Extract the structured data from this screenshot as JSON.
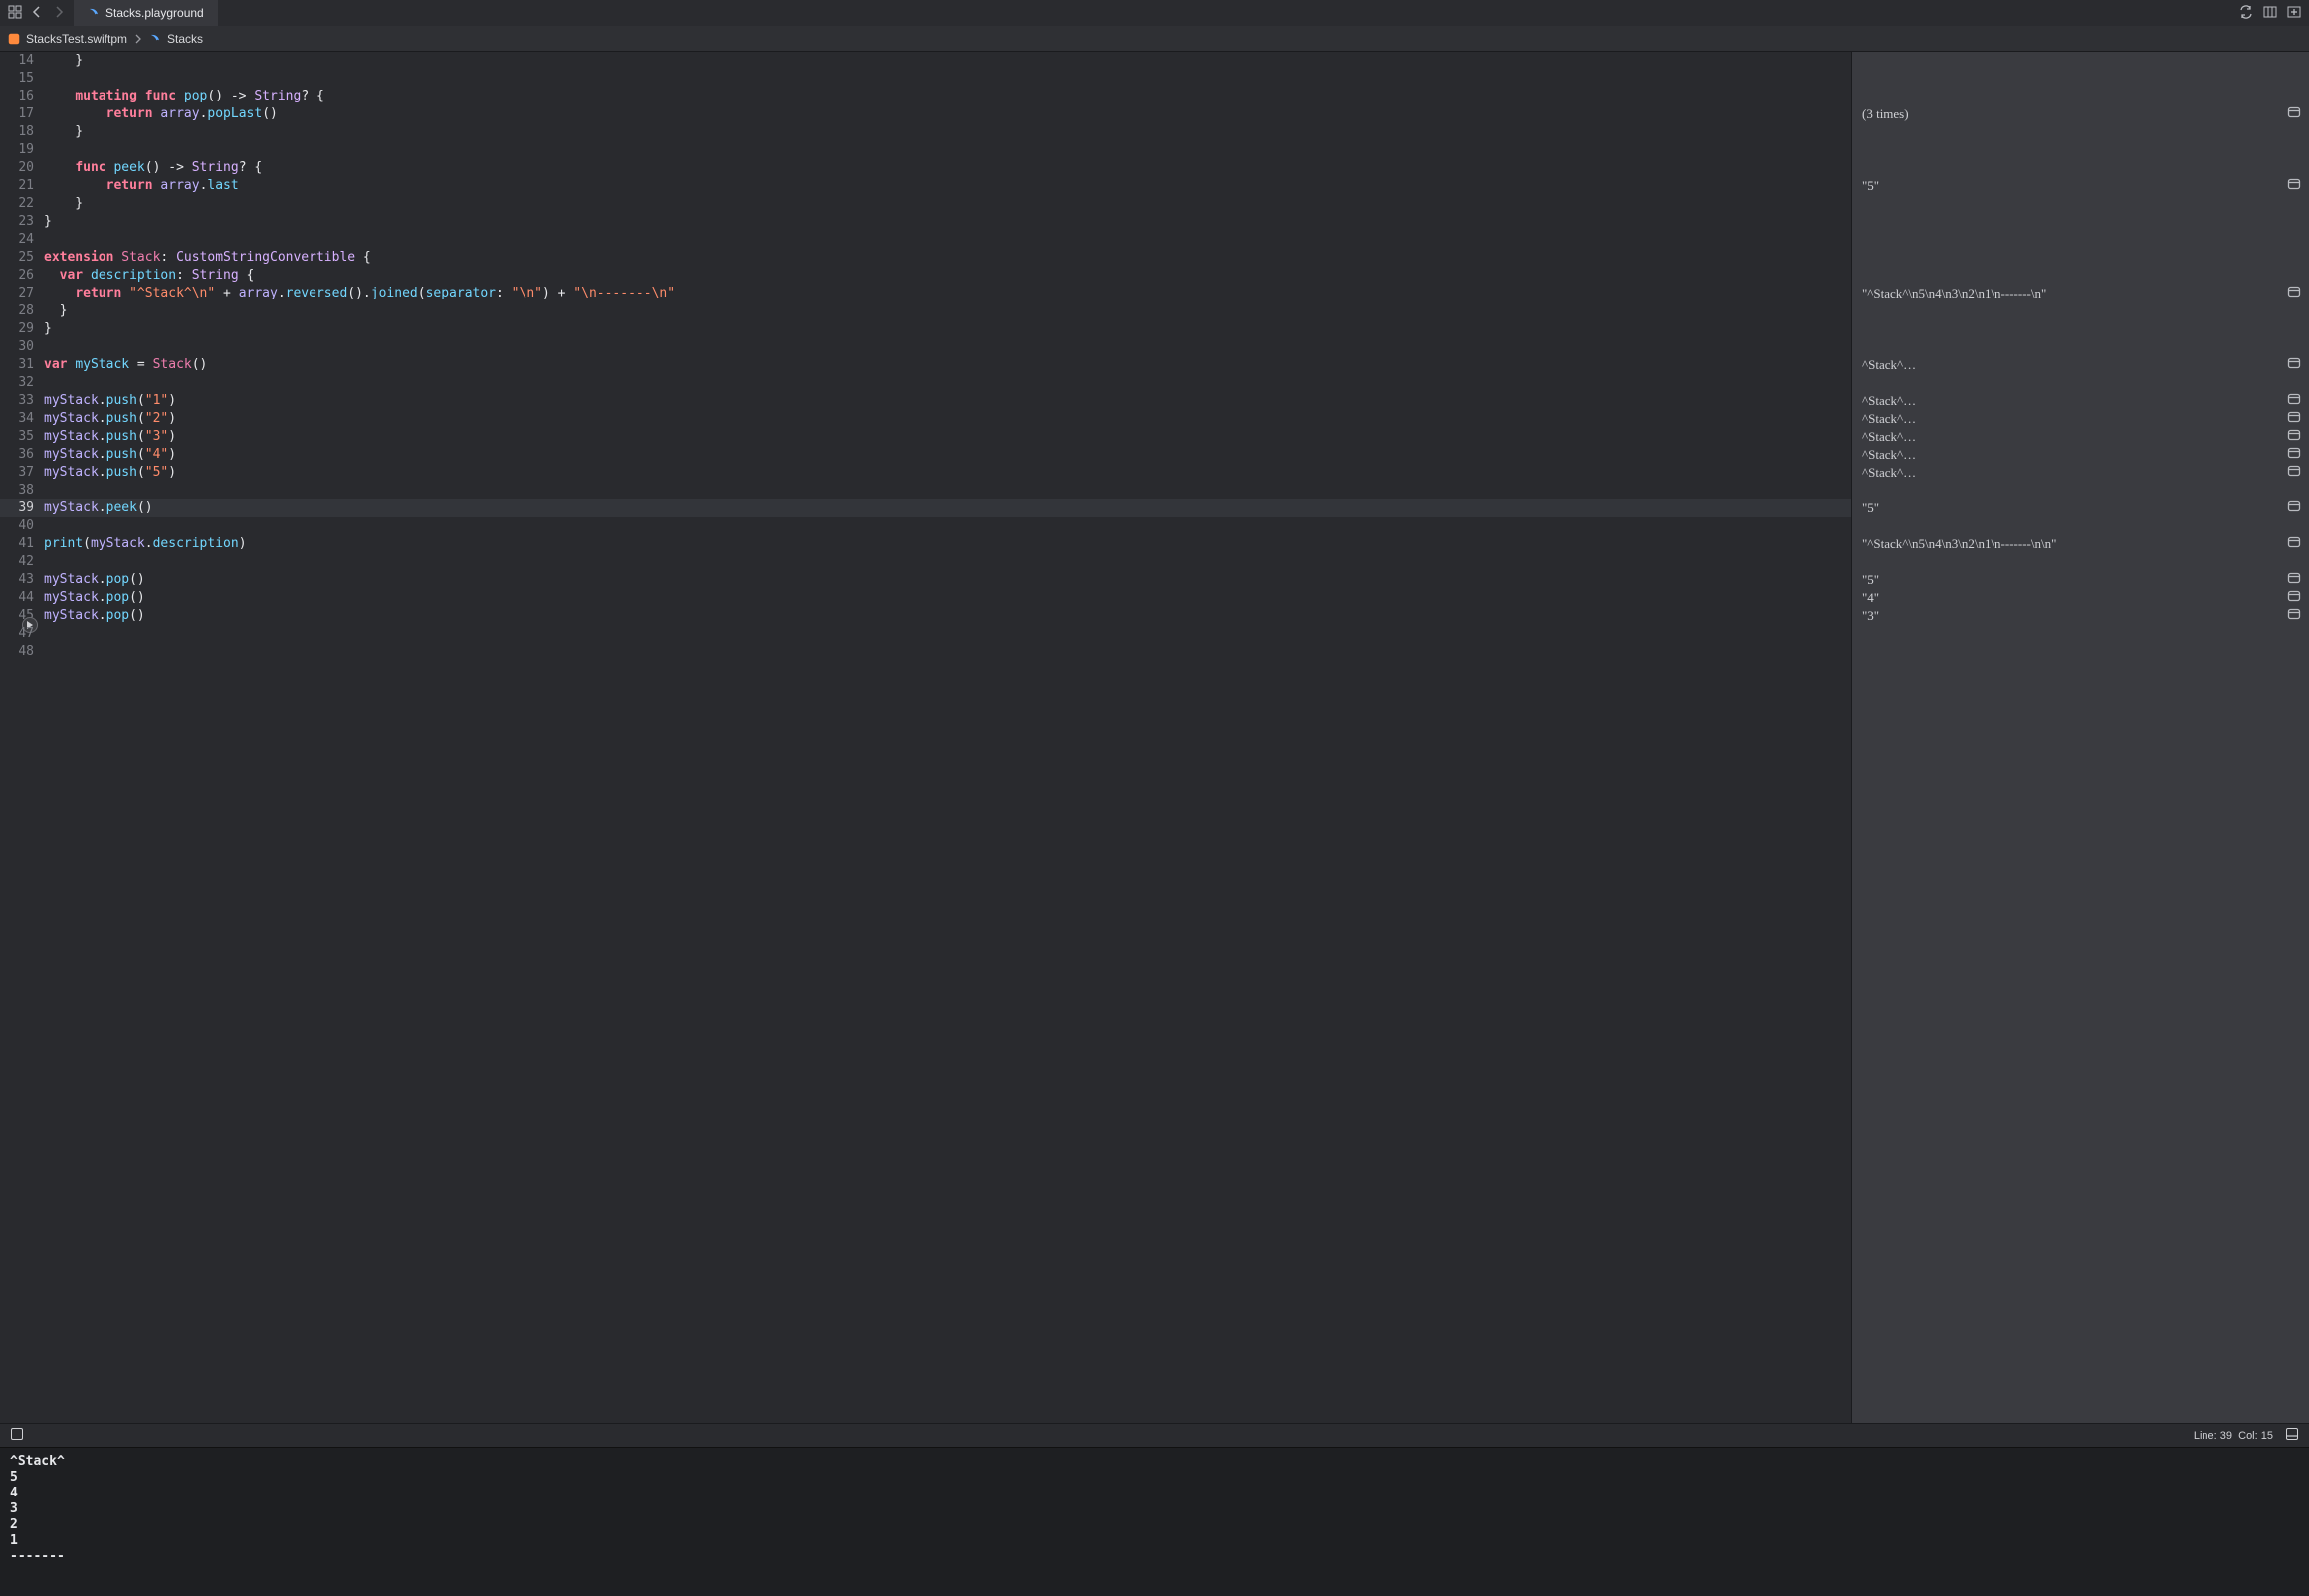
{
  "toolbar": {
    "tab_label": "Stacks.playground"
  },
  "breadcrumb": {
    "project": "StacksTest.swiftpm",
    "file": "Stacks"
  },
  "editor": {
    "first_line_number": 14,
    "current_line_number": 39,
    "play_line_number": 46,
    "lines": [
      {
        "n": 14,
        "tokens": [
          {
            "t": "    }",
            "c": "tok-plain"
          }
        ]
      },
      {
        "n": 15,
        "tokens": []
      },
      {
        "n": 16,
        "tokens": [
          {
            "t": "    ",
            "c": ""
          },
          {
            "t": "mutating func ",
            "c": "tok-kw"
          },
          {
            "t": "pop",
            "c": "tok-fn"
          },
          {
            "t": "() -> ",
            "c": "tok-plain"
          },
          {
            "t": "String",
            "c": "tok-type"
          },
          {
            "t": "? {",
            "c": "tok-plain"
          }
        ]
      },
      {
        "n": 17,
        "tokens": [
          {
            "t": "        ",
            "c": ""
          },
          {
            "t": "return ",
            "c": "tok-kw"
          },
          {
            "t": "array",
            "c": "tok-id"
          },
          {
            "t": ".",
            "c": "tok-plain"
          },
          {
            "t": "popLast",
            "c": "tok-name"
          },
          {
            "t": "()",
            "c": "tok-plain"
          }
        ]
      },
      {
        "n": 18,
        "tokens": [
          {
            "t": "    }",
            "c": "tok-plain"
          }
        ]
      },
      {
        "n": 19,
        "tokens": []
      },
      {
        "n": 20,
        "tokens": [
          {
            "t": "    ",
            "c": ""
          },
          {
            "t": "func ",
            "c": "tok-kw"
          },
          {
            "t": "peek",
            "c": "tok-fn"
          },
          {
            "t": "() -> ",
            "c": "tok-plain"
          },
          {
            "t": "String",
            "c": "tok-type"
          },
          {
            "t": "? {",
            "c": "tok-plain"
          }
        ]
      },
      {
        "n": 21,
        "tokens": [
          {
            "t": "        ",
            "c": ""
          },
          {
            "t": "return ",
            "c": "tok-kw"
          },
          {
            "t": "array",
            "c": "tok-id"
          },
          {
            "t": ".",
            "c": "tok-plain"
          },
          {
            "t": "last",
            "c": "tok-name"
          }
        ]
      },
      {
        "n": 22,
        "tokens": [
          {
            "t": "    }",
            "c": "tok-plain"
          }
        ]
      },
      {
        "n": 23,
        "tokens": [
          {
            "t": "}",
            "c": "tok-plain"
          }
        ]
      },
      {
        "n": 24,
        "tokens": []
      },
      {
        "n": 25,
        "tokens": [
          {
            "t": "extension ",
            "c": "tok-kw"
          },
          {
            "t": "Stack",
            "c": "tok-pink"
          },
          {
            "t": ": ",
            "c": "tok-plain"
          },
          {
            "t": "CustomStringConvertible",
            "c": "tok-type"
          },
          {
            "t": " {",
            "c": "tok-plain"
          }
        ]
      },
      {
        "n": 26,
        "tokens": [
          {
            "t": "  ",
            "c": ""
          },
          {
            "t": "var ",
            "c": "tok-kw"
          },
          {
            "t": "description",
            "c": "tok-fn"
          },
          {
            "t": ": ",
            "c": "tok-plain"
          },
          {
            "t": "String",
            "c": "tok-type"
          },
          {
            "t": " {",
            "c": "tok-plain"
          }
        ]
      },
      {
        "n": 27,
        "tokens": [
          {
            "t": "    ",
            "c": ""
          },
          {
            "t": "return ",
            "c": "tok-kw"
          },
          {
            "t": "\"^Stack^\\n\"",
            "c": "tok-str"
          },
          {
            "t": " + ",
            "c": "tok-plain"
          },
          {
            "t": "array",
            "c": "tok-id"
          },
          {
            "t": ".",
            "c": "tok-plain"
          },
          {
            "t": "reversed",
            "c": "tok-name"
          },
          {
            "t": "().",
            "c": "tok-plain"
          },
          {
            "t": "joined",
            "c": "tok-name"
          },
          {
            "t": "(",
            "c": "tok-plain"
          },
          {
            "t": "separator",
            "c": "tok-name"
          },
          {
            "t": ": ",
            "c": "tok-plain"
          },
          {
            "t": "\"\\n\"",
            "c": "tok-str"
          },
          {
            "t": ") + ",
            "c": "tok-plain"
          },
          {
            "t": "\"\\n-------\\n\"",
            "c": "tok-str"
          }
        ]
      },
      {
        "n": 28,
        "tokens": [
          {
            "t": "  }",
            "c": "tok-plain"
          }
        ]
      },
      {
        "n": 29,
        "tokens": [
          {
            "t": "}",
            "c": "tok-plain"
          }
        ]
      },
      {
        "n": 30,
        "tokens": []
      },
      {
        "n": 31,
        "tokens": [
          {
            "t": "var ",
            "c": "tok-kw"
          },
          {
            "t": "myStack",
            "c": "tok-fn"
          },
          {
            "t": " = ",
            "c": "tok-plain"
          },
          {
            "t": "Stack",
            "c": "tok-pink"
          },
          {
            "t": "()",
            "c": "tok-plain"
          }
        ]
      },
      {
        "n": 32,
        "tokens": []
      },
      {
        "n": 33,
        "tokens": [
          {
            "t": "myStack",
            "c": "tok-id"
          },
          {
            "t": ".",
            "c": "tok-plain"
          },
          {
            "t": "push",
            "c": "tok-name"
          },
          {
            "t": "(",
            "c": "tok-plain"
          },
          {
            "t": "\"1\"",
            "c": "tok-str"
          },
          {
            "t": ")",
            "c": "tok-plain"
          }
        ]
      },
      {
        "n": 34,
        "tokens": [
          {
            "t": "myStack",
            "c": "tok-id"
          },
          {
            "t": ".",
            "c": "tok-plain"
          },
          {
            "t": "push",
            "c": "tok-name"
          },
          {
            "t": "(",
            "c": "tok-plain"
          },
          {
            "t": "\"2\"",
            "c": "tok-str"
          },
          {
            "t": ")",
            "c": "tok-plain"
          }
        ]
      },
      {
        "n": 35,
        "tokens": [
          {
            "t": "myStack",
            "c": "tok-id"
          },
          {
            "t": ".",
            "c": "tok-plain"
          },
          {
            "t": "push",
            "c": "tok-name"
          },
          {
            "t": "(",
            "c": "tok-plain"
          },
          {
            "t": "\"3\"",
            "c": "tok-str"
          },
          {
            "t": ")",
            "c": "tok-plain"
          }
        ]
      },
      {
        "n": 36,
        "tokens": [
          {
            "t": "myStack",
            "c": "tok-id"
          },
          {
            "t": ".",
            "c": "tok-plain"
          },
          {
            "t": "push",
            "c": "tok-name"
          },
          {
            "t": "(",
            "c": "tok-plain"
          },
          {
            "t": "\"4\"",
            "c": "tok-str"
          },
          {
            "t": ")",
            "c": "tok-plain"
          }
        ]
      },
      {
        "n": 37,
        "tokens": [
          {
            "t": "myStack",
            "c": "tok-id"
          },
          {
            "t": ".",
            "c": "tok-plain"
          },
          {
            "t": "push",
            "c": "tok-name"
          },
          {
            "t": "(",
            "c": "tok-plain"
          },
          {
            "t": "\"5\"",
            "c": "tok-str"
          },
          {
            "t": ")",
            "c": "tok-plain"
          }
        ]
      },
      {
        "n": 38,
        "tokens": []
      },
      {
        "n": 39,
        "tokens": [
          {
            "t": "myStack",
            "c": "tok-id"
          },
          {
            "t": ".",
            "c": "tok-plain"
          },
          {
            "t": "peek",
            "c": "tok-name"
          },
          {
            "t": "()",
            "c": "tok-plain"
          }
        ]
      },
      {
        "n": 40,
        "tokens": []
      },
      {
        "n": 41,
        "tokens": [
          {
            "t": "print",
            "c": "tok-name"
          },
          {
            "t": "(",
            "c": "tok-plain"
          },
          {
            "t": "myStack",
            "c": "tok-id"
          },
          {
            "t": ".",
            "c": "tok-plain"
          },
          {
            "t": "description",
            "c": "tok-name"
          },
          {
            "t": ")",
            "c": "tok-plain"
          }
        ]
      },
      {
        "n": 42,
        "tokens": []
      },
      {
        "n": 43,
        "tokens": [
          {
            "t": "myStack",
            "c": "tok-id"
          },
          {
            "t": ".",
            "c": "tok-plain"
          },
          {
            "t": "pop",
            "c": "tok-name"
          },
          {
            "t": "()",
            "c": "tok-plain"
          }
        ]
      },
      {
        "n": 44,
        "tokens": [
          {
            "t": "myStack",
            "c": "tok-id"
          },
          {
            "t": ".",
            "c": "tok-plain"
          },
          {
            "t": "pop",
            "c": "tok-name"
          },
          {
            "t": "()",
            "c": "tok-plain"
          }
        ]
      },
      {
        "n": 45,
        "tokens": [
          {
            "t": "myStack",
            "c": "tok-id"
          },
          {
            "t": ".",
            "c": "tok-plain"
          },
          {
            "t": "pop",
            "c": "tok-name"
          },
          {
            "t": "()",
            "c": "tok-plain"
          }
        ]
      },
      {
        "n": 46,
        "tokens": []
      },
      {
        "n": 47,
        "tokens": []
      },
      {
        "n": 48,
        "tokens": []
      }
    ]
  },
  "results": [
    {
      "n": 14,
      "text": ""
    },
    {
      "n": 15,
      "text": ""
    },
    {
      "n": 16,
      "text": ""
    },
    {
      "n": 17,
      "text": "(3 times)",
      "eye": true
    },
    {
      "n": 18,
      "text": ""
    },
    {
      "n": 19,
      "text": ""
    },
    {
      "n": 20,
      "text": ""
    },
    {
      "n": 21,
      "text": "\"5\"",
      "eye": true
    },
    {
      "n": 22,
      "text": ""
    },
    {
      "n": 23,
      "text": ""
    },
    {
      "n": 24,
      "text": ""
    },
    {
      "n": 25,
      "text": ""
    },
    {
      "n": 26,
      "text": ""
    },
    {
      "n": 27,
      "text": "\"^Stack^\\n5\\n4\\n3\\n2\\n1\\n-------\\n\"",
      "eye": true
    },
    {
      "n": 28,
      "text": ""
    },
    {
      "n": 29,
      "text": ""
    },
    {
      "n": 30,
      "text": ""
    },
    {
      "n": 31,
      "text": "^Stack^…",
      "eye": true
    },
    {
      "n": 32,
      "text": ""
    },
    {
      "n": 33,
      "text": "^Stack^…",
      "eye": true
    },
    {
      "n": 34,
      "text": "^Stack^…",
      "eye": true
    },
    {
      "n": 35,
      "text": "^Stack^…",
      "eye": true
    },
    {
      "n": 36,
      "text": "^Stack^…",
      "eye": true
    },
    {
      "n": 37,
      "text": "^Stack^…",
      "eye": true
    },
    {
      "n": 38,
      "text": ""
    },
    {
      "n": 39,
      "text": "\"5\"",
      "eye": true
    },
    {
      "n": 40,
      "text": ""
    },
    {
      "n": 41,
      "text": "\"^Stack^\\n5\\n4\\n3\\n2\\n1\\n-------\\n\\n\"",
      "eye": true
    },
    {
      "n": 42,
      "text": ""
    },
    {
      "n": 43,
      "text": "\"5\"",
      "eye": true
    },
    {
      "n": 44,
      "text": "\"4\"",
      "eye": true
    },
    {
      "n": 45,
      "text": "\"3\"",
      "eye": true
    },
    {
      "n": 46,
      "text": ""
    },
    {
      "n": 47,
      "text": ""
    },
    {
      "n": 48,
      "text": ""
    }
  ],
  "status": {
    "line_label": "Line:",
    "line_value": "39",
    "col_label": "Col:",
    "col_value": "15"
  },
  "console_output": "^Stack^\n5\n4\n3\n2\n1\n-------\n"
}
